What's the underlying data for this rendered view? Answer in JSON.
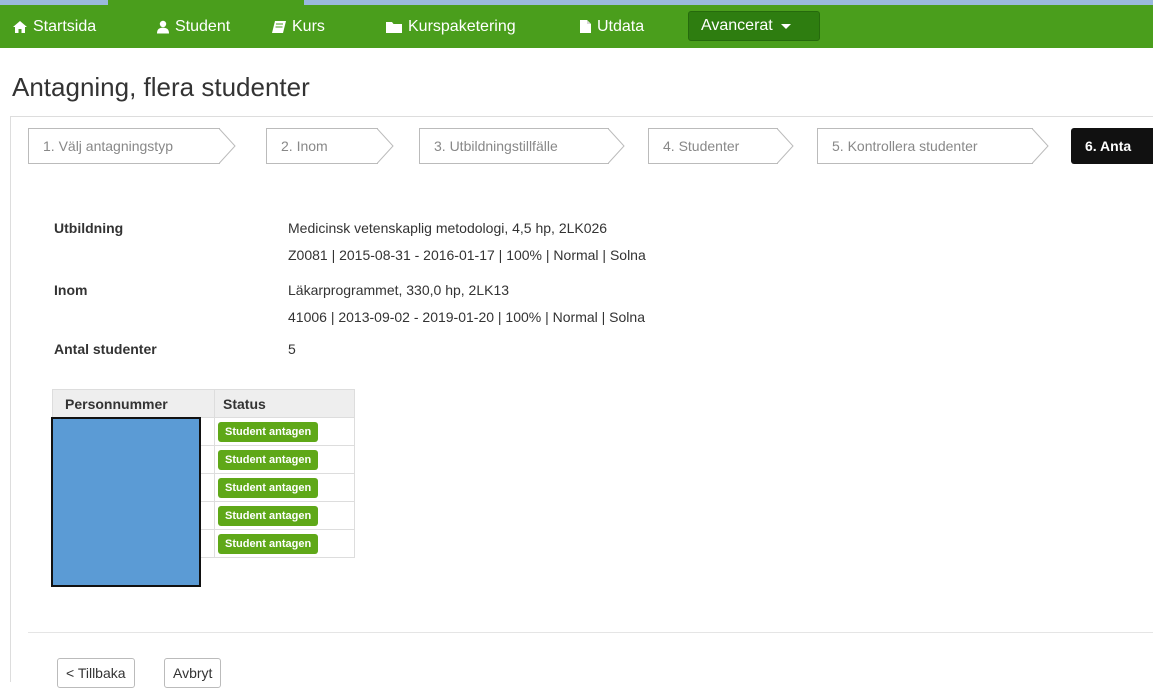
{
  "nav": {
    "items": [
      {
        "label": "Startsida",
        "icon": "home-icon"
      },
      {
        "label": "Student",
        "icon": "user-icon"
      },
      {
        "label": "Kurs",
        "icon": "book-icon"
      },
      {
        "label": "Kurspaketering",
        "icon": "folder-icon"
      },
      {
        "label": "Utdata",
        "icon": "file-icon"
      }
    ],
    "dropdown_label": "Avancerat"
  },
  "page_title": "Antagning, flera studenter",
  "steps": [
    "1. Välj antagningstyp",
    "2. Inom",
    "3. Utbildningstillfälle",
    "4. Studenter",
    "5. Kontrollera studenter",
    "6. Anta"
  ],
  "details": {
    "utbildning_label": "Utbildning",
    "utbildning_line1": "Medicinsk vetenskaplig metodologi, 4,5 hp, 2LK026",
    "utbildning_line2": "Z0081 | 2015-08-31 - 2016-01-17 | 100% | Normal | Solna",
    "inom_label": "Inom",
    "inom_line1": "Läkarprogrammet, 330,0 hp, 2LK13",
    "inom_line2": "41006 | 2013-09-02 - 2019-01-20 | 100% | Normal | Solna",
    "antal_label": "Antal studenter",
    "antal_value": "5"
  },
  "table": {
    "headers": [
      "Personnummer",
      "Status"
    ],
    "rows": [
      {
        "status": "Student antagen"
      },
      {
        "status": "Student antagen"
      },
      {
        "status": "Student antagen"
      },
      {
        "status": "Student antagen"
      },
      {
        "status": "Student antagen"
      }
    ]
  },
  "buttons": {
    "back": "< Tillbaka",
    "cancel": "Avbryt"
  },
  "colors": {
    "nav_green": "#4a9e1c",
    "dropdown_green": "#2e7d10",
    "badge_green": "#5fa818",
    "active_step": "#111111",
    "redaction": "#5b9bd5"
  }
}
